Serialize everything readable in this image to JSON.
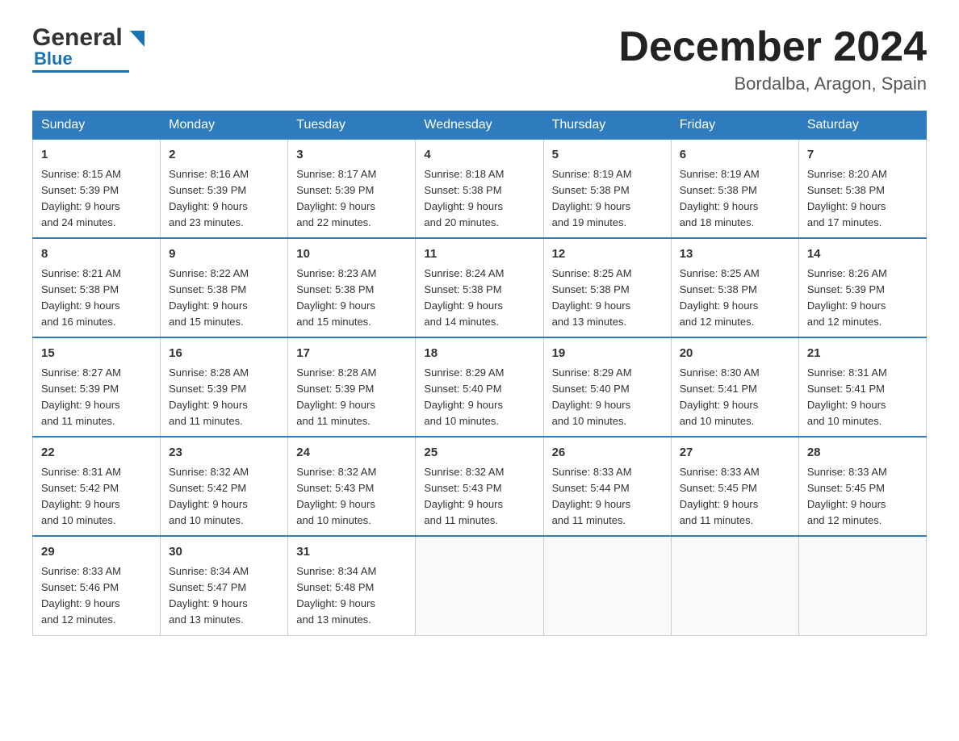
{
  "header": {
    "logo_general": "General",
    "logo_blue": "Blue",
    "month_title": "December 2024",
    "location": "Bordalba, Aragon, Spain"
  },
  "days_of_week": [
    "Sunday",
    "Monday",
    "Tuesday",
    "Wednesday",
    "Thursday",
    "Friday",
    "Saturday"
  ],
  "weeks": [
    [
      {
        "day": "1",
        "sunrise": "8:15 AM",
        "sunset": "5:39 PM",
        "daylight": "9 hours and 24 minutes."
      },
      {
        "day": "2",
        "sunrise": "8:16 AM",
        "sunset": "5:39 PM",
        "daylight": "9 hours and 23 minutes."
      },
      {
        "day": "3",
        "sunrise": "8:17 AM",
        "sunset": "5:39 PM",
        "daylight": "9 hours and 22 minutes."
      },
      {
        "day": "4",
        "sunrise": "8:18 AM",
        "sunset": "5:38 PM",
        "daylight": "9 hours and 20 minutes."
      },
      {
        "day": "5",
        "sunrise": "8:19 AM",
        "sunset": "5:38 PM",
        "daylight": "9 hours and 19 minutes."
      },
      {
        "day": "6",
        "sunrise": "8:19 AM",
        "sunset": "5:38 PM",
        "daylight": "9 hours and 18 minutes."
      },
      {
        "day": "7",
        "sunrise": "8:20 AM",
        "sunset": "5:38 PM",
        "daylight": "9 hours and 17 minutes."
      }
    ],
    [
      {
        "day": "8",
        "sunrise": "8:21 AM",
        "sunset": "5:38 PM",
        "daylight": "9 hours and 16 minutes."
      },
      {
        "day": "9",
        "sunrise": "8:22 AM",
        "sunset": "5:38 PM",
        "daylight": "9 hours and 15 minutes."
      },
      {
        "day": "10",
        "sunrise": "8:23 AM",
        "sunset": "5:38 PM",
        "daylight": "9 hours and 15 minutes."
      },
      {
        "day": "11",
        "sunrise": "8:24 AM",
        "sunset": "5:38 PM",
        "daylight": "9 hours and 14 minutes."
      },
      {
        "day": "12",
        "sunrise": "8:25 AM",
        "sunset": "5:38 PM",
        "daylight": "9 hours and 13 minutes."
      },
      {
        "day": "13",
        "sunrise": "8:25 AM",
        "sunset": "5:38 PM",
        "daylight": "9 hours and 12 minutes."
      },
      {
        "day": "14",
        "sunrise": "8:26 AM",
        "sunset": "5:39 PM",
        "daylight": "9 hours and 12 minutes."
      }
    ],
    [
      {
        "day": "15",
        "sunrise": "8:27 AM",
        "sunset": "5:39 PM",
        "daylight": "9 hours and 11 minutes."
      },
      {
        "day": "16",
        "sunrise": "8:28 AM",
        "sunset": "5:39 PM",
        "daylight": "9 hours and 11 minutes."
      },
      {
        "day": "17",
        "sunrise": "8:28 AM",
        "sunset": "5:39 PM",
        "daylight": "9 hours and 11 minutes."
      },
      {
        "day": "18",
        "sunrise": "8:29 AM",
        "sunset": "5:40 PM",
        "daylight": "9 hours and 10 minutes."
      },
      {
        "day": "19",
        "sunrise": "8:29 AM",
        "sunset": "5:40 PM",
        "daylight": "9 hours and 10 minutes."
      },
      {
        "day": "20",
        "sunrise": "8:30 AM",
        "sunset": "5:41 PM",
        "daylight": "9 hours and 10 minutes."
      },
      {
        "day": "21",
        "sunrise": "8:31 AM",
        "sunset": "5:41 PM",
        "daylight": "9 hours and 10 minutes."
      }
    ],
    [
      {
        "day": "22",
        "sunrise": "8:31 AM",
        "sunset": "5:42 PM",
        "daylight": "9 hours and 10 minutes."
      },
      {
        "day": "23",
        "sunrise": "8:32 AM",
        "sunset": "5:42 PM",
        "daylight": "9 hours and 10 minutes."
      },
      {
        "day": "24",
        "sunrise": "8:32 AM",
        "sunset": "5:43 PM",
        "daylight": "9 hours and 10 minutes."
      },
      {
        "day": "25",
        "sunrise": "8:32 AM",
        "sunset": "5:43 PM",
        "daylight": "9 hours and 11 minutes."
      },
      {
        "day": "26",
        "sunrise": "8:33 AM",
        "sunset": "5:44 PM",
        "daylight": "9 hours and 11 minutes."
      },
      {
        "day": "27",
        "sunrise": "8:33 AM",
        "sunset": "5:45 PM",
        "daylight": "9 hours and 11 minutes."
      },
      {
        "day": "28",
        "sunrise": "8:33 AM",
        "sunset": "5:45 PM",
        "daylight": "9 hours and 12 minutes."
      }
    ],
    [
      {
        "day": "29",
        "sunrise": "8:33 AM",
        "sunset": "5:46 PM",
        "daylight": "9 hours and 12 minutes."
      },
      {
        "day": "30",
        "sunrise": "8:34 AM",
        "sunset": "5:47 PM",
        "daylight": "9 hours and 13 minutes."
      },
      {
        "day": "31",
        "sunrise": "8:34 AM",
        "sunset": "5:48 PM",
        "daylight": "9 hours and 13 minutes."
      },
      null,
      null,
      null,
      null
    ]
  ],
  "labels": {
    "sunrise": "Sunrise:",
    "sunset": "Sunset:",
    "daylight": "Daylight:"
  }
}
